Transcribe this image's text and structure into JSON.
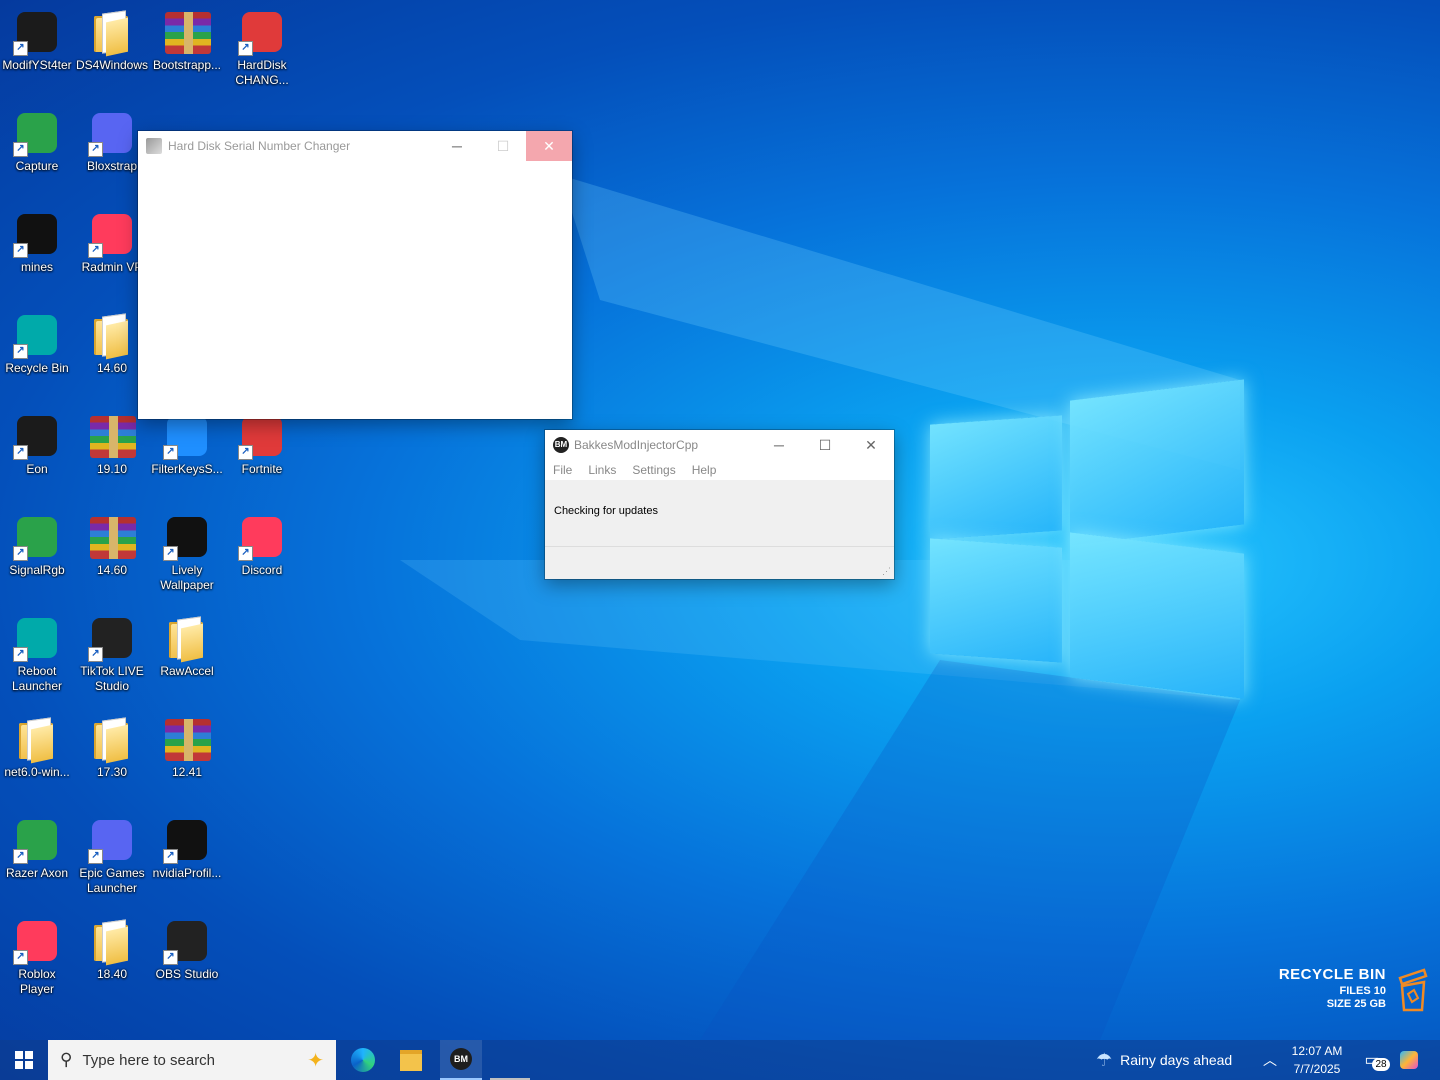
{
  "desktop": {
    "icons": [
      {
        "label": "ModifYSt4ter",
        "type": "app"
      },
      {
        "label": "DS4Windows",
        "type": "folder"
      },
      {
        "label": "Bootstrapp...",
        "type": "rar"
      },
      {
        "label": "HardDisk CHANG...",
        "type": "app"
      },
      {
        "label": "Capture",
        "type": "app"
      },
      {
        "label": "Bloxstrap",
        "type": "app"
      },
      {
        "label": "mines",
        "type": "app"
      },
      {
        "label": "Radmin VP",
        "type": "app"
      },
      {
        "label": "Recycle Bin",
        "type": "app"
      },
      {
        "label": "14.60",
        "type": "folder"
      },
      {
        "label": "Eon",
        "type": "app"
      },
      {
        "label": "19.10",
        "type": "rar"
      },
      {
        "label": "FilterKeysS...",
        "type": "app"
      },
      {
        "label": "Fortnite",
        "type": "app"
      },
      {
        "label": "SignalRgb",
        "type": "app"
      },
      {
        "label": "14.60",
        "type": "rar"
      },
      {
        "label": "Lively Wallpaper",
        "type": "app"
      },
      {
        "label": "Discord",
        "type": "app"
      },
      {
        "label": "Reboot Launcher",
        "type": "app"
      },
      {
        "label": "TikTok LIVE Studio",
        "type": "app"
      },
      {
        "label": "RawAccel",
        "type": "folder"
      },
      {
        "label": "net6.0-win...",
        "type": "folder"
      },
      {
        "label": "17.30",
        "type": "folder"
      },
      {
        "label": "12.41",
        "type": "rar"
      },
      {
        "label": "Razer Axon",
        "type": "app"
      },
      {
        "label": "Epic Games Launcher",
        "type": "app"
      },
      {
        "label": "nvidiaProfil...",
        "type": "app"
      },
      {
        "label": "Roblox Player",
        "type": "app"
      },
      {
        "label": "18.40",
        "type": "folder"
      },
      {
        "label": "OBS Studio",
        "type": "app"
      }
    ]
  },
  "hdd_window": {
    "title": "Hard Disk Serial Number Changer",
    "minimize": "─",
    "maximize": "☐",
    "close": "✕"
  },
  "bakkes_window": {
    "title": "BakkesModInjectorCpp",
    "menu": [
      "File",
      "Links",
      "Settings",
      "Help"
    ],
    "status": "Checking for updates",
    "minimize": "─",
    "maximize": "☐",
    "close": "✕"
  },
  "recycle_widget": {
    "title": "RECYCLE BIN",
    "files": "FILES 10",
    "size": "SIZE 25 GB"
  },
  "taskbar": {
    "search_placeholder": "Type here to search",
    "weather": "Rainy days ahead",
    "time": "12:07 AM",
    "date": "7/7/2025",
    "notifications": "28"
  },
  "colors": {
    "accent": "#0078d7",
    "close_hover": "#f1707a"
  }
}
